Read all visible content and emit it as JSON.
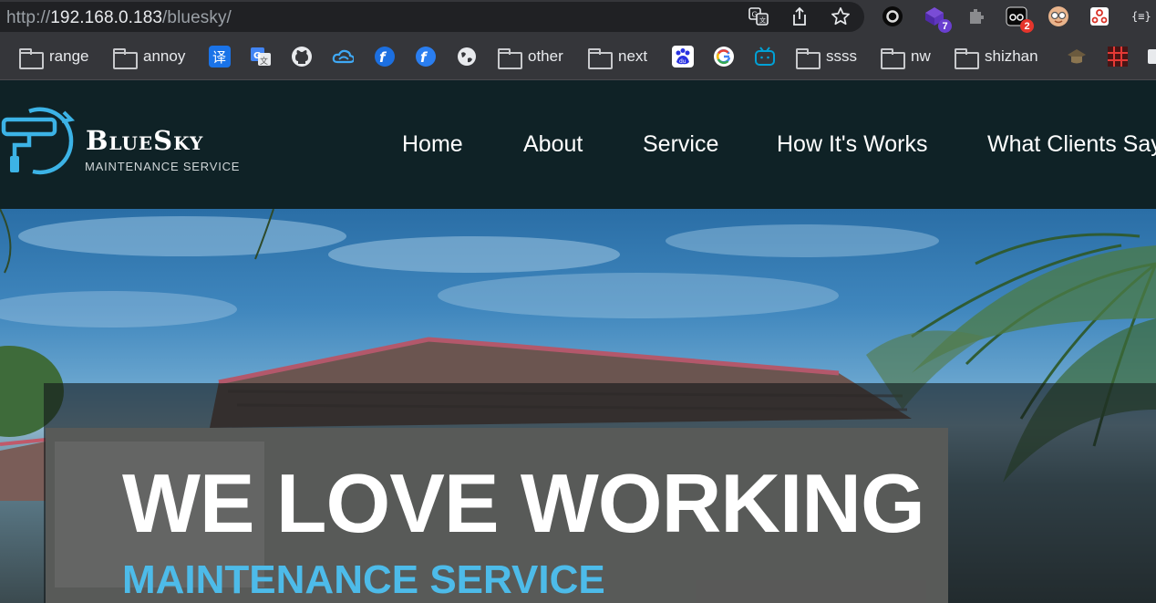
{
  "browser": {
    "url_scheme": "http://",
    "url_host": "192.168.0.183",
    "url_path": "/bluesky/",
    "extension_badges": {
      "purple": "7",
      "black": "2"
    }
  },
  "bookmarks": {
    "items": [
      "range",
      "annoy",
      "other",
      "next",
      "ssss",
      "nw",
      "shizhan"
    ],
    "icons": [
      "translate-icon",
      "google-translate-icon",
      "github-icon",
      "cloud-icon",
      "f-blue-icon",
      "f-blue-icon-2",
      "globe-icon",
      "baidu-icon",
      "google-icon",
      "bilibili-icon",
      "hat-icon",
      "grid-red-icon"
    ]
  },
  "site": {
    "logo_name": "BlueSky",
    "logo_tagline": "MAINTENANCE SERVICE",
    "nav": [
      "Home",
      "About",
      "Service",
      "How It's Works",
      "What Clients Say"
    ],
    "hero_title": "WE LOVE WORKING",
    "hero_subtitle": "MAINTENANCE SERVICE",
    "colors": {
      "header_bg": "#0f2226",
      "accent": "#4dbbe9"
    }
  }
}
